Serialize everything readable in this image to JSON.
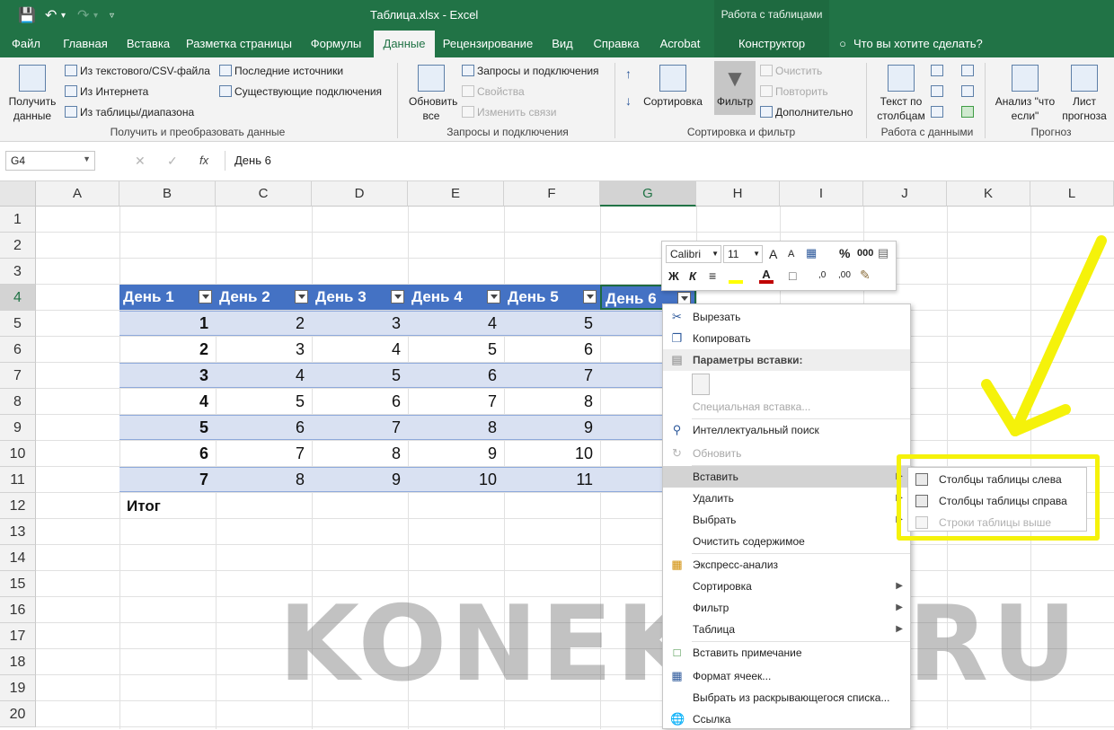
{
  "window": {
    "title": "Таблица.xlsx  -  Excel",
    "context_title": "Работа с таблицами"
  },
  "tabs": [
    "Файл",
    "Главная",
    "Вставка",
    "Разметка страницы",
    "Формулы",
    "Данные",
    "Рецензирование",
    "Вид",
    "Справка",
    "Acrobat",
    "Конструктор"
  ],
  "tell_me": "Что вы хотите сделать?",
  "ribbon": {
    "get_data": "Получить данные",
    "from_csv": "Из текстового/CSV-файла",
    "from_web": "Из Интернета",
    "from_table": "Из таблицы/диапазона",
    "recent_sources": "Последние источники",
    "existing_conn": "Существующие подключения",
    "group1": "Получить и преобразовать данные",
    "refresh_all": "Обновить все",
    "queries_conn": "Запросы и подключения",
    "properties": "Свойства",
    "edit_links": "Изменить связи",
    "group2": "Запросы и подключения",
    "sort": "Сортировка",
    "filter": "Фильтр",
    "clear": "Очистить",
    "reapply": "Повторить",
    "advanced": "Дополнительно",
    "group3": "Сортировка и фильтр",
    "text_to_cols": "Текст по столбцам",
    "group4": "Работа с данными",
    "whatif": "Анализ \"что если\"",
    "forecast_sheet": "Лист прогноза",
    "group5": "Прогноз"
  },
  "formula_bar": {
    "name_box": "G4",
    "cancel": "✕",
    "enter": "✓",
    "fx": "fx",
    "content": "День 6"
  },
  "columns": [
    "A",
    "B",
    "C",
    "D",
    "E",
    "F",
    "G",
    "H",
    "I",
    "J",
    "K",
    "L"
  ],
  "rows": [
    "1",
    "2",
    "3",
    "4",
    "5",
    "6",
    "7",
    "8",
    "9",
    "10",
    "11",
    "12",
    "13",
    "14",
    "15",
    "16",
    "17",
    "18",
    "19",
    "20"
  ],
  "table": {
    "headers": [
      "День 1",
      "День 2",
      "День 3",
      "День 4",
      "День 5",
      "День 6"
    ],
    "body": [
      [
        "1",
        "2",
        "3",
        "4",
        "5"
      ],
      [
        "2",
        "3",
        "4",
        "5",
        "6"
      ],
      [
        "3",
        "4",
        "5",
        "6",
        "7"
      ],
      [
        "4",
        "5",
        "6",
        "7",
        "8"
      ],
      [
        "5",
        "6",
        "7",
        "8",
        "9"
      ],
      [
        "6",
        "7",
        "8",
        "9",
        "10"
      ],
      [
        "7",
        "8",
        "9",
        "10",
        "11"
      ]
    ],
    "total_label": "Итог"
  },
  "minibar": {
    "font": "Calibri",
    "size": "11",
    "grow": "A",
    "shrink": "A",
    "percent": "%",
    "thousands": "000",
    "bold": "Ж",
    "italic": "К"
  },
  "context_menu": {
    "cut": "Вырезать",
    "copy": "Копировать",
    "paste_options": "Параметры вставки:",
    "paste_special": "Специальная вставка...",
    "smart_lookup": "Интеллектуальный поиск",
    "refresh": "Обновить",
    "insert": "Вставить",
    "delete": "Удалить",
    "select": "Выбрать",
    "clear_contents": "Очистить содержимое",
    "quick_analysis": "Экспресс-анализ",
    "sort": "Сортировка",
    "filter": "Фильтр",
    "table": "Таблица",
    "insert_comment": "Вставить примечание",
    "format_cells": "Формат ячеек...",
    "pick_list": "Выбрать из раскрывающегося списка...",
    "link": "Ссылка"
  },
  "submenu": {
    "cols_left": "Столбцы таблицы слева",
    "cols_right": "Столбцы таблицы справа",
    "rows_above": "Строки таблицы выше"
  },
  "watermark": "KONEKTO.RU",
  "colors": {
    "excel_green": "#217346",
    "table_header": "#4472c4",
    "band": "#d9e1f2",
    "highlight": "#f5f20a"
  }
}
